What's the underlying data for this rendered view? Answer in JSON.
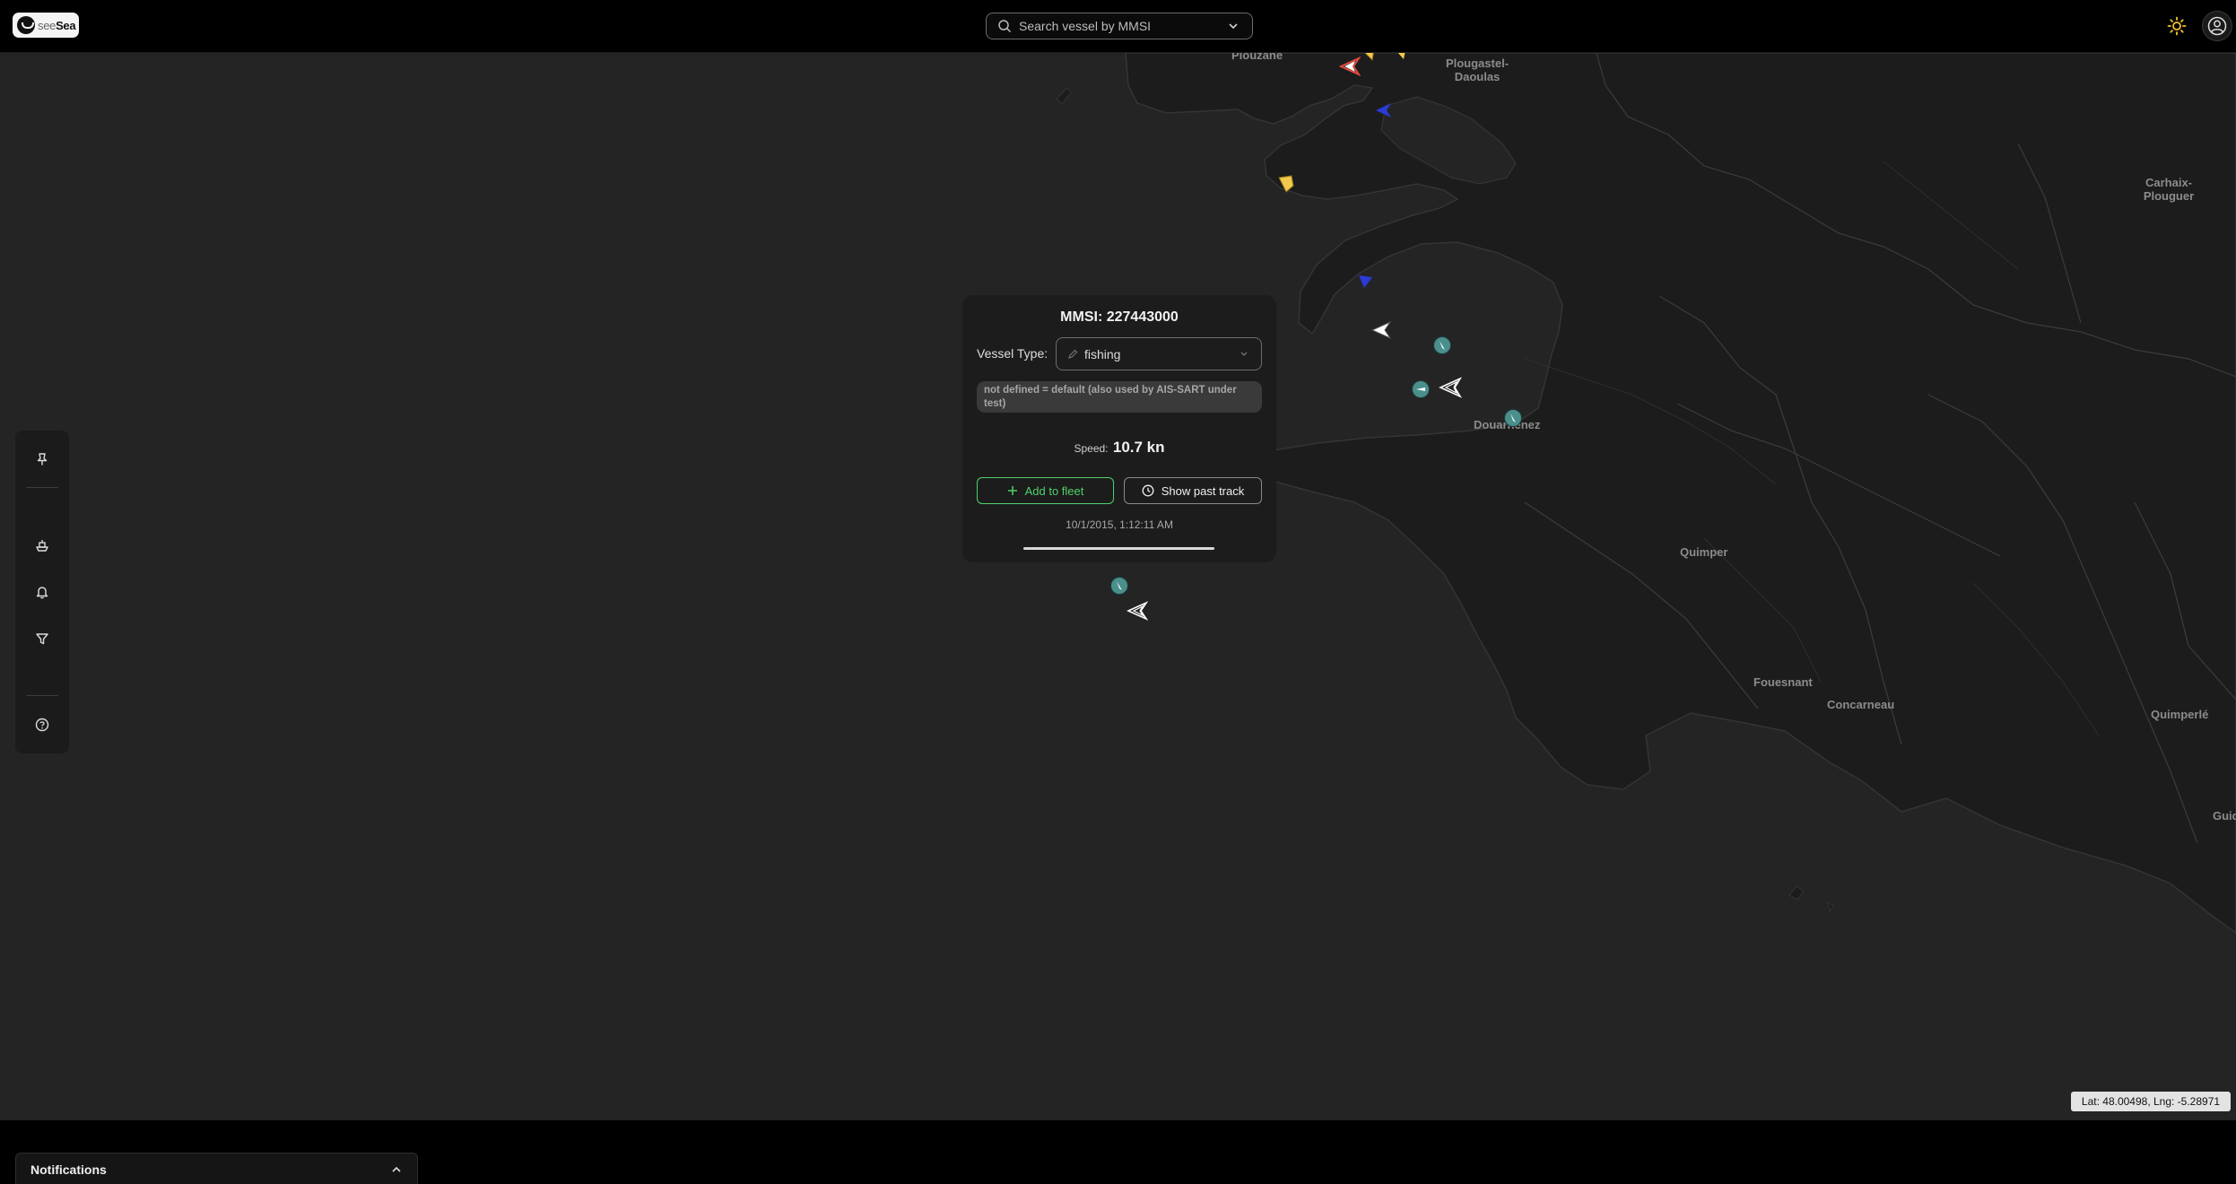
{
  "app": {
    "logo_text_a": "see",
    "logo_text_b": "Sea"
  },
  "search": {
    "placeholder": "Search vessel by MMSI",
    "value": ""
  },
  "map": {
    "places": [
      "Plouzané",
      "Plougastel-Daoulas",
      "Carhaix-Plouguer",
      "Douarnenez",
      "Quimper",
      "Fouesnant",
      "Concarneau",
      "Quimperlé",
      "Guidel"
    ],
    "coordinates": "Lat: 48.00498, Lng: -5.28971"
  },
  "popup": {
    "title": "MMSI: 227443000",
    "vessel_type_label": "Vessel Type:",
    "vessel_type_value": "fishing",
    "note": "not defined = default (also used by AIS-SART under test)",
    "speed_label": "Speed:",
    "speed_value": "10.7 kn",
    "add_to_fleet": "Add to fleet",
    "show_past_track": "Show past track",
    "timestamp": "10/1/2015, 1:12:11 AM",
    "timeline_position": 1.0
  },
  "sidebar": {
    "icons": [
      "pin-icon",
      "ship-icon",
      "bell-icon",
      "filter-icon",
      "help-icon"
    ]
  },
  "notifications": {
    "title": "Notifications"
  },
  "colors": {
    "accent_green": "#4fd16a",
    "marker_teal": "#4a8f8c",
    "marker_yellow": "#f2c94c",
    "marker_blue": "#2b3bd6",
    "marker_red": "#e04a3f",
    "sun_yellow": "#f2c230"
  }
}
